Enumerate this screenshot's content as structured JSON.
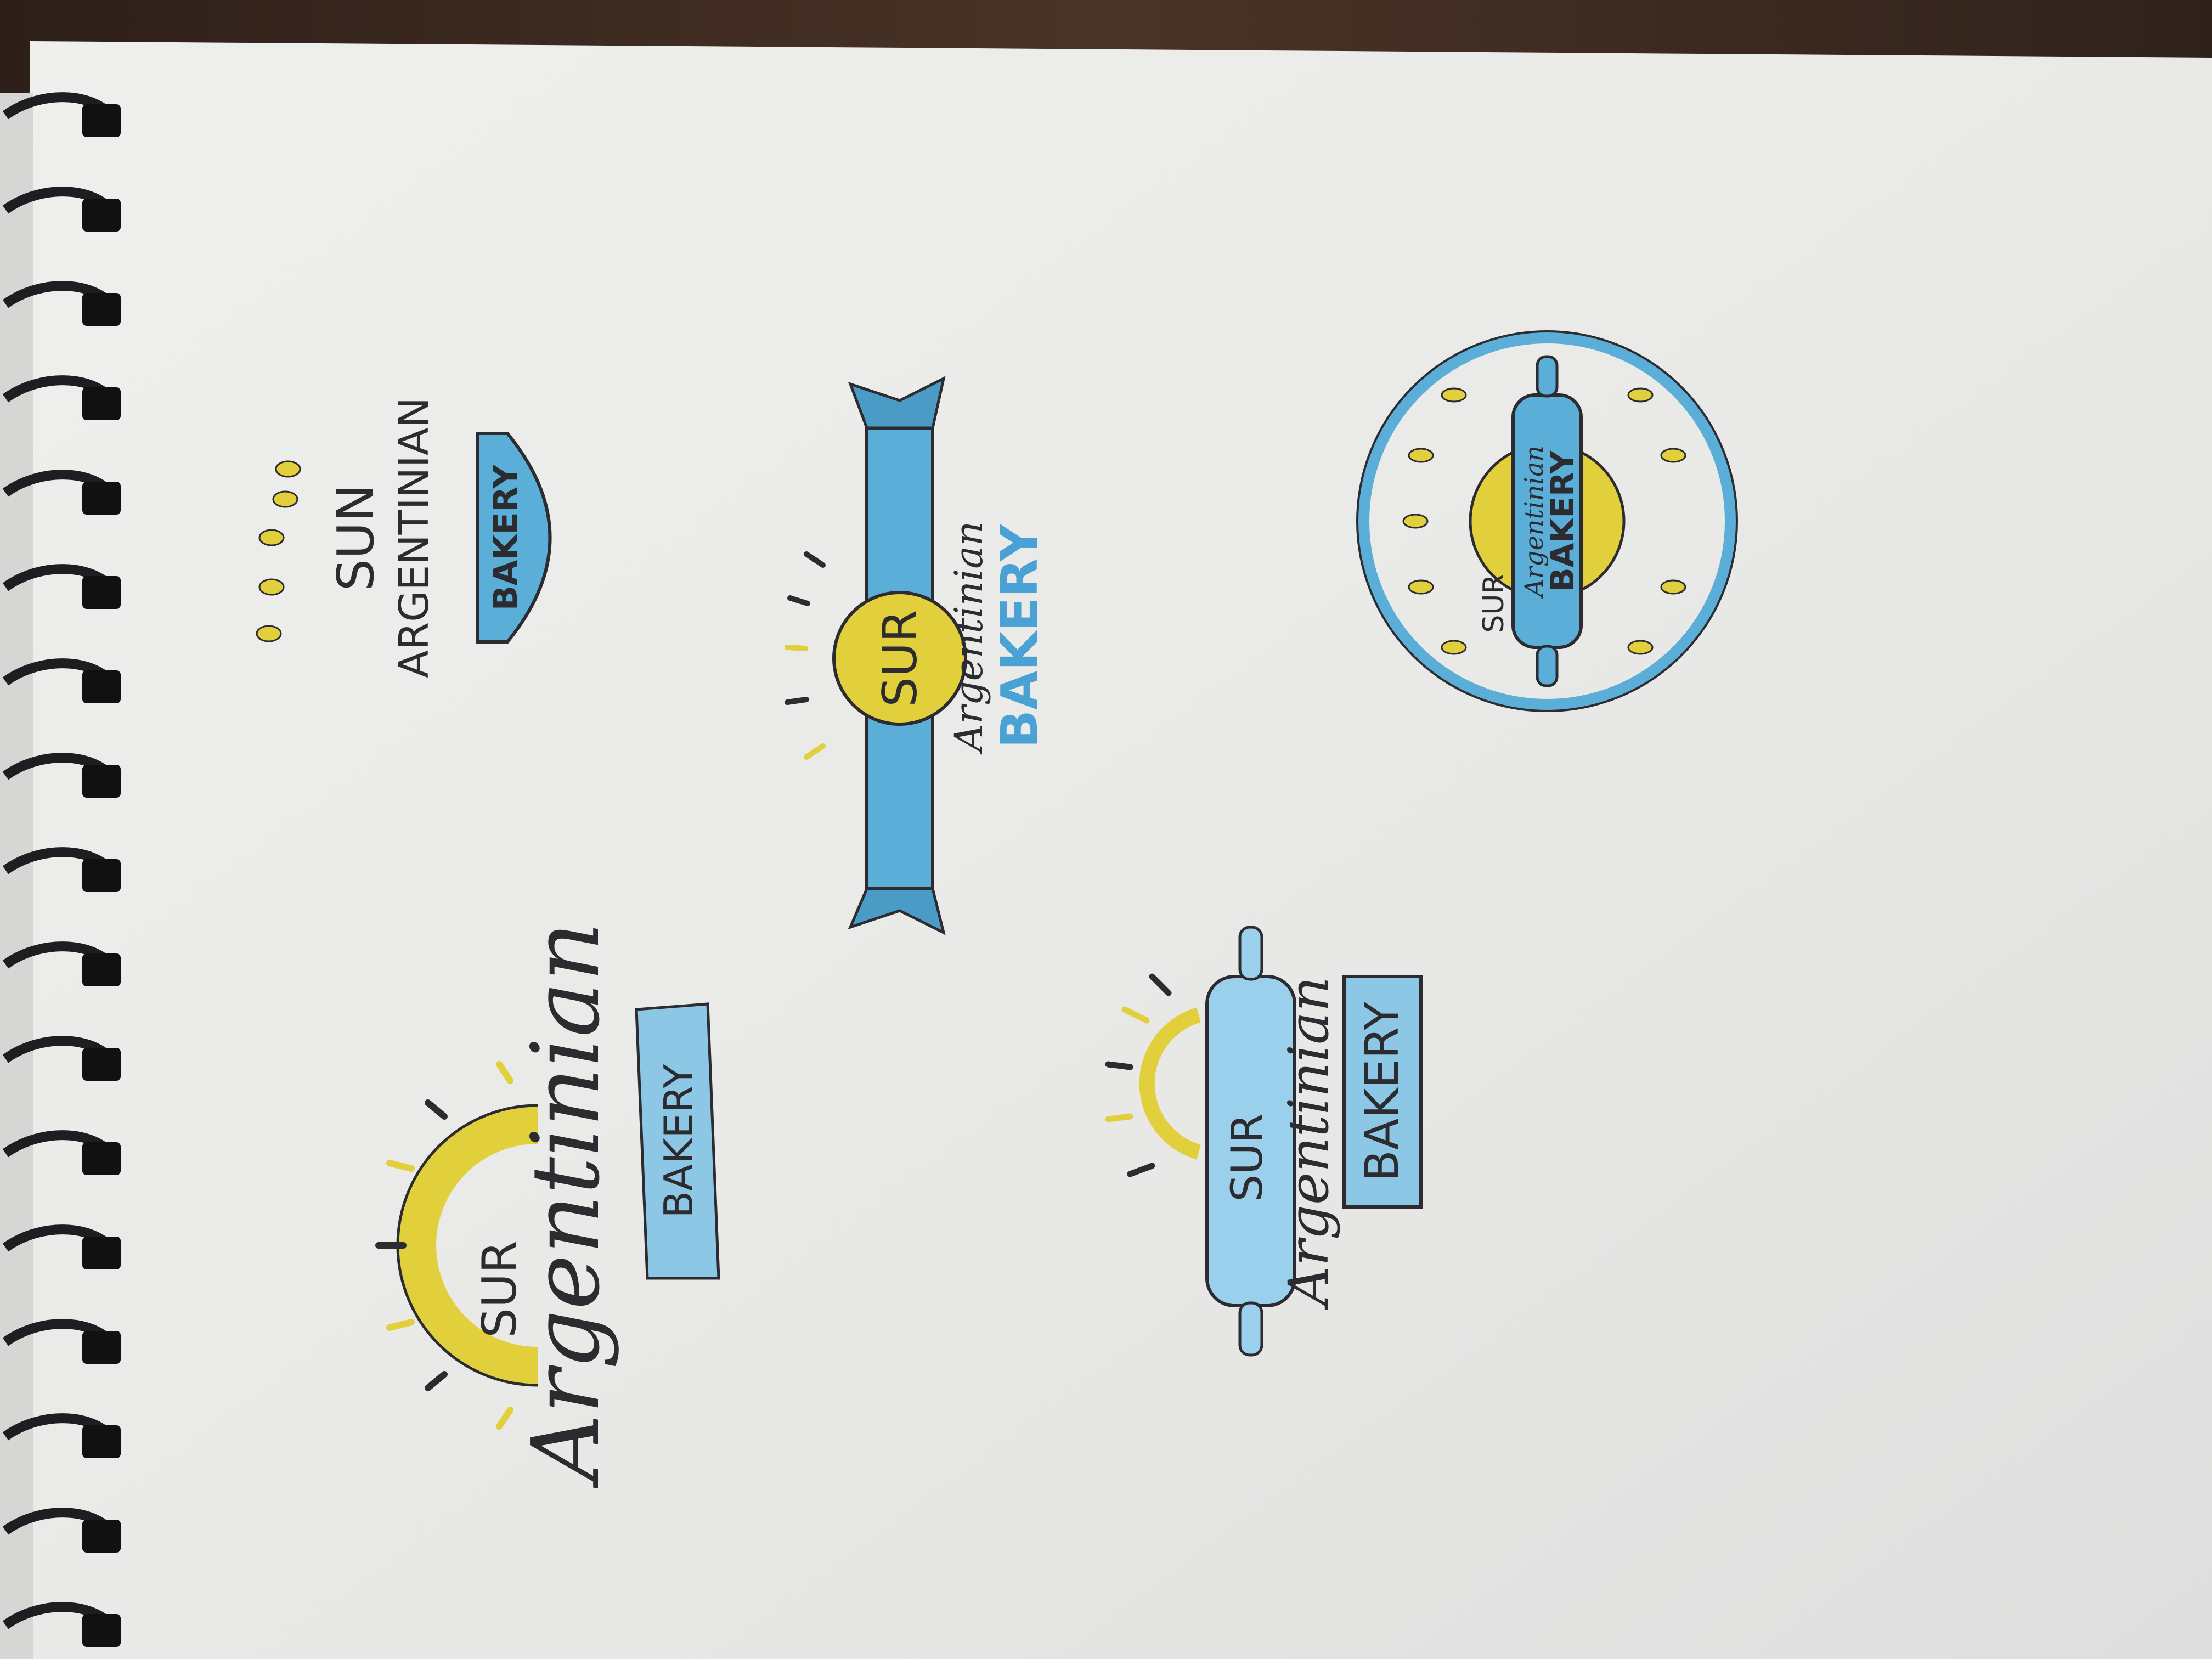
{
  "sketchbook": {
    "sketches": [
      {
        "id": "sketch-1",
        "name": "SUN",
        "subtitle": "ARGENTINIAN",
        "banner": "BAKERY"
      },
      {
        "id": "sketch-2",
        "badge": "SUR",
        "subtitle": "Argentinian",
        "banner": "BAKERY"
      },
      {
        "id": "sketch-3",
        "badge": "SUR",
        "subtitle": "Argentinian",
        "banner": "BAKERY"
      },
      {
        "id": "sketch-4",
        "name": "SUR",
        "subtitle": "Argentinian",
        "banner": "BAKERY"
      },
      {
        "id": "sketch-5",
        "badge": "SUR",
        "subtitle": "Argentinian",
        "banner": "BAKERY"
      }
    ]
  },
  "colors": {
    "paper": "#ebebea",
    "table": "#3a2a22",
    "ink": "#2b2b30",
    "pencil_blue": "#5aaed8",
    "pencil_yellow": "#e2cf3c",
    "spiral": "#1e1e22"
  }
}
